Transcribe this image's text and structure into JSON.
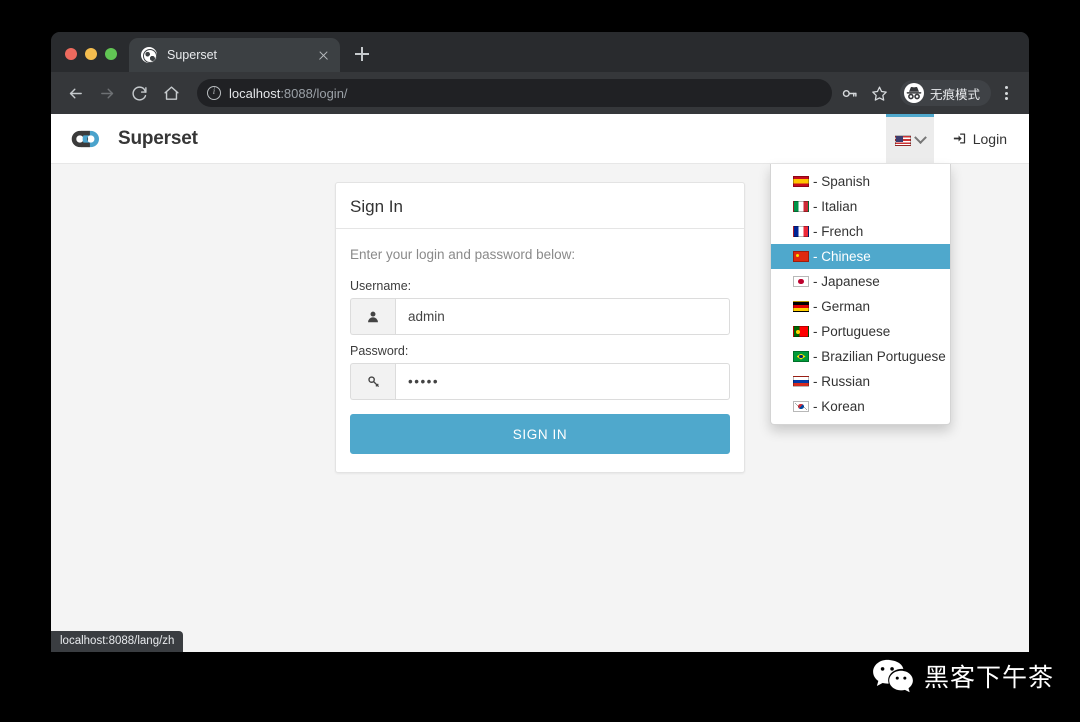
{
  "browser": {
    "tab": {
      "title": "Superset",
      "favicon": "globe-icon"
    },
    "new_tab_label": "+",
    "nav": {
      "back": "back-arrow",
      "forward": "forward-arrow",
      "reload": "reload-icon",
      "home": "home-icon"
    },
    "omnibox": {
      "url_host": "localhost",
      "url_rest": ":8088/login/",
      "info_icon": "info-circle-icon"
    },
    "toolbar_right": {
      "password_key_icon": "key-icon",
      "bookmark_star_icon": "star-icon",
      "incognito_label": "无痕模式",
      "menu_icon": "three-dots-icon"
    }
  },
  "navbar": {
    "brand": "Superset",
    "language_button": {
      "flag": "flag-us",
      "chevron": "chevron-down-icon"
    },
    "login_label": "Login"
  },
  "language_dropdown": {
    "items": [
      {
        "flag": "flag-es",
        "label": "- Spanish",
        "selected": false
      },
      {
        "flag": "flag-it",
        "label": "- Italian",
        "selected": false
      },
      {
        "flag": "flag-fr",
        "label": "- French",
        "selected": false
      },
      {
        "flag": "flag-cn",
        "label": "- Chinese",
        "selected": true
      },
      {
        "flag": "flag-jp",
        "label": "- Japanese",
        "selected": false
      },
      {
        "flag": "flag-de",
        "label": "- German",
        "selected": false
      },
      {
        "flag": "flag-pt",
        "label": "- Portuguese",
        "selected": false
      },
      {
        "flag": "flag-br",
        "label": "- Brazilian Portuguese",
        "selected": false
      },
      {
        "flag": "flag-ru",
        "label": "- Russian",
        "selected": false
      },
      {
        "flag": "flag-kr",
        "label": "- Korean",
        "selected": false
      }
    ]
  },
  "signin": {
    "title": "Sign In",
    "hint": "Enter your login and password below:",
    "username_label": "Username:",
    "username_value": "admin",
    "username_placeholder": "",
    "username_icon": "user-icon",
    "password_label": "Password:",
    "password_value": "•••••",
    "password_placeholder": "",
    "password_icon": "key-icon",
    "submit_label": "SIGN IN"
  },
  "status_bar": {
    "url": "localhost:8088/lang/zh"
  },
  "watermark": {
    "text": "黑客下午茶",
    "icon": "wechat-icon"
  },
  "colors": {
    "accent": "#4fa8cc",
    "page_bg": "#f4f4f4",
    "browser_chrome": "#292b2e",
    "toolbar": "#35373a"
  }
}
